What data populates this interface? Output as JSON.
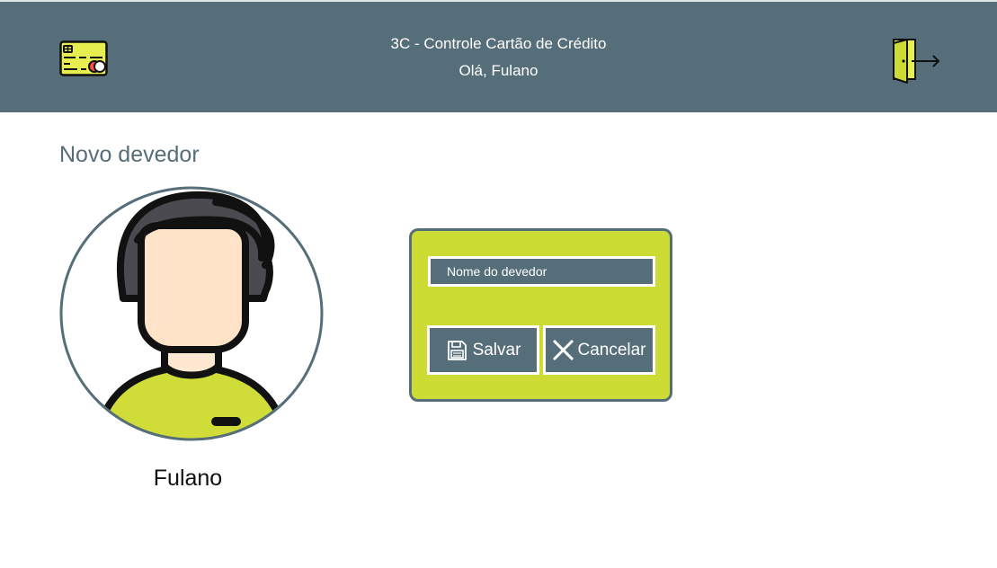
{
  "header": {
    "title": "3C - Controle Cartão de Crédito",
    "greeting": "Olá, Fulano",
    "logo_icon": "credit-card-icon",
    "logout_icon": "logout-door-icon",
    "background_color": "#566e79"
  },
  "page": {
    "title": "Novo devedor"
  },
  "user": {
    "name": "Fulano",
    "avatar_icon": "user-avatar-icon"
  },
  "form": {
    "name_placeholder": "Nome do devedor",
    "name_value": "",
    "save_label": "Salvar",
    "save_icon": "floppy-disk-icon",
    "cancel_label": "Cancelar",
    "cancel_icon": "close-x-icon",
    "panel_color": "#cddc35"
  }
}
